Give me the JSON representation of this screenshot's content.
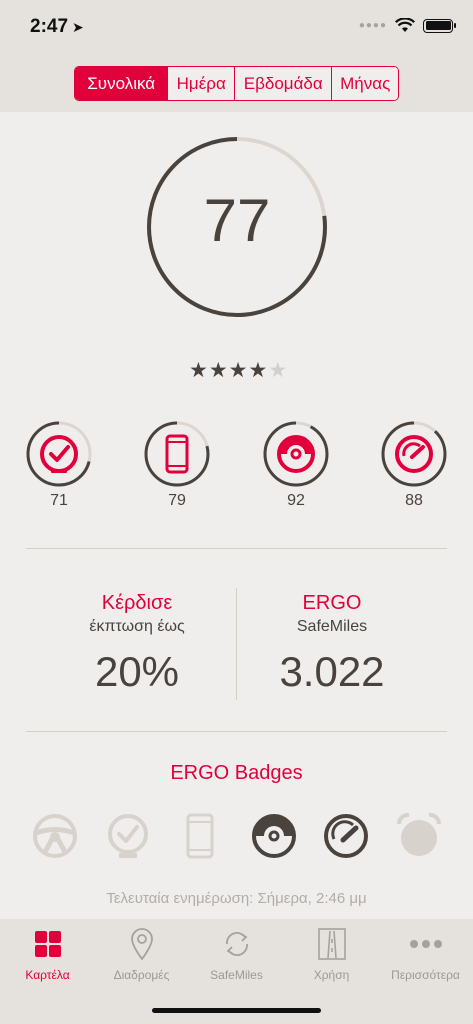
{
  "status": {
    "time": "2:47",
    "location_icon": "location-arrow-icon"
  },
  "segments": [
    {
      "label": "Συνολικά",
      "active": true
    },
    {
      "label": "Ημέρα",
      "active": false
    },
    {
      "label": "Εβδομάδα",
      "active": false
    },
    {
      "label": "Μήνας",
      "active": false
    }
  ],
  "score": {
    "value": "77",
    "progress": 0.77,
    "rating": 4,
    "max_rating": 5
  },
  "categories": [
    {
      "icon": "stopwatch-check-icon",
      "value": "71",
      "progress": 0.71
    },
    {
      "icon": "phone-icon",
      "value": "79",
      "progress": 0.79
    },
    {
      "icon": "brake-disc-icon",
      "value": "92",
      "progress": 0.92
    },
    {
      "icon": "speedometer-icon",
      "value": "88",
      "progress": 0.88
    }
  ],
  "promo_left": {
    "line1": "Κέρδισε",
    "line2": "έκπτωση έως",
    "value": "20%"
  },
  "promo_right": {
    "line1": "ERGO",
    "line2": "SafeMiles",
    "value": "3.022"
  },
  "badges": {
    "title": "ERGO Badges",
    "items": [
      {
        "icon": "steering-wheel-badge-icon",
        "earned": false
      },
      {
        "icon": "stopwatch-check-badge-icon",
        "earned": false
      },
      {
        "icon": "phone-badge-icon",
        "earned": false
      },
      {
        "icon": "brake-disc-badge-icon",
        "earned": true
      },
      {
        "icon": "speedometer-badge-icon",
        "earned": true
      },
      {
        "icon": "alarm-clock-badge-icon",
        "earned": false
      }
    ]
  },
  "updated": "Τελευταία ενημέρωση: Σήμερα, 2:46 μμ",
  "tabs": [
    {
      "label": "Καρτέλα",
      "icon": "dashboard-grid-icon",
      "active": true
    },
    {
      "label": "Διαδρομές",
      "icon": "map-pin-icon",
      "active": false
    },
    {
      "label": "SafeMiles",
      "icon": "refresh-cycle-icon",
      "active": false
    },
    {
      "label": "Χρήση",
      "icon": "road-icon",
      "active": false
    },
    {
      "label": "Περισσότερα",
      "icon": "more-dots-icon",
      "active": false
    }
  ],
  "colors": {
    "accent": "#e2003c",
    "dark": "#4a423d",
    "ring_bg": "#ddd6d0",
    "muted": "#d2cfcc"
  }
}
